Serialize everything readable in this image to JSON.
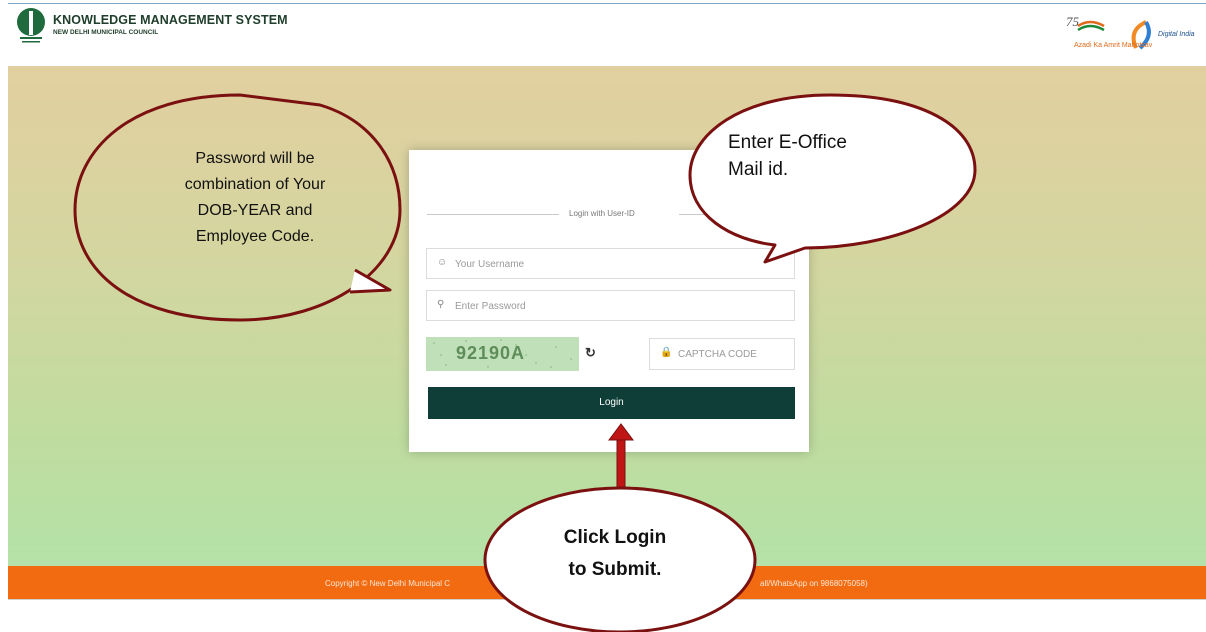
{
  "header": {
    "title": "KNOWLEDGE MANAGEMENT SYSTEM",
    "subtitle": "NEW DELHI MUNICIPAL COUNCIL",
    "logo_left": "ndmc-emblem",
    "logo_right_1": "azadi-ka-amrit-mahotsav-logo",
    "logo_right_2": "digital-india-logo",
    "azadi_text": "Azadi Ka Amrit Mahotsav",
    "digital_india_text": "Digital India"
  },
  "login": {
    "divider_label": "Login with User-ID",
    "username_placeholder": "Your Username",
    "password_placeholder": "Enter Password",
    "captcha_value": "92190A",
    "captcha_placeholder": "CAPTCHA CODE",
    "submit_label": "Login"
  },
  "footer": {
    "left_text": "Copyright © New Delhi Municipal C",
    "right_text": "all/WhatsApp on 9868075058)"
  },
  "callouts": {
    "password_hint_lines": [
      "Password will be",
      "combination of Your",
      "DOB-YEAR and",
      "Employee Code."
    ],
    "username_hint_lines": [
      "Enter E-Office",
      "Mail id."
    ],
    "login_hint_lines": [
      "Click Login",
      "to Submit."
    ]
  },
  "colors": {
    "footer": "#f36b10",
    "login_button": "#0f3d37",
    "callout_border": "#7a1010",
    "arrow": "#c01515"
  }
}
